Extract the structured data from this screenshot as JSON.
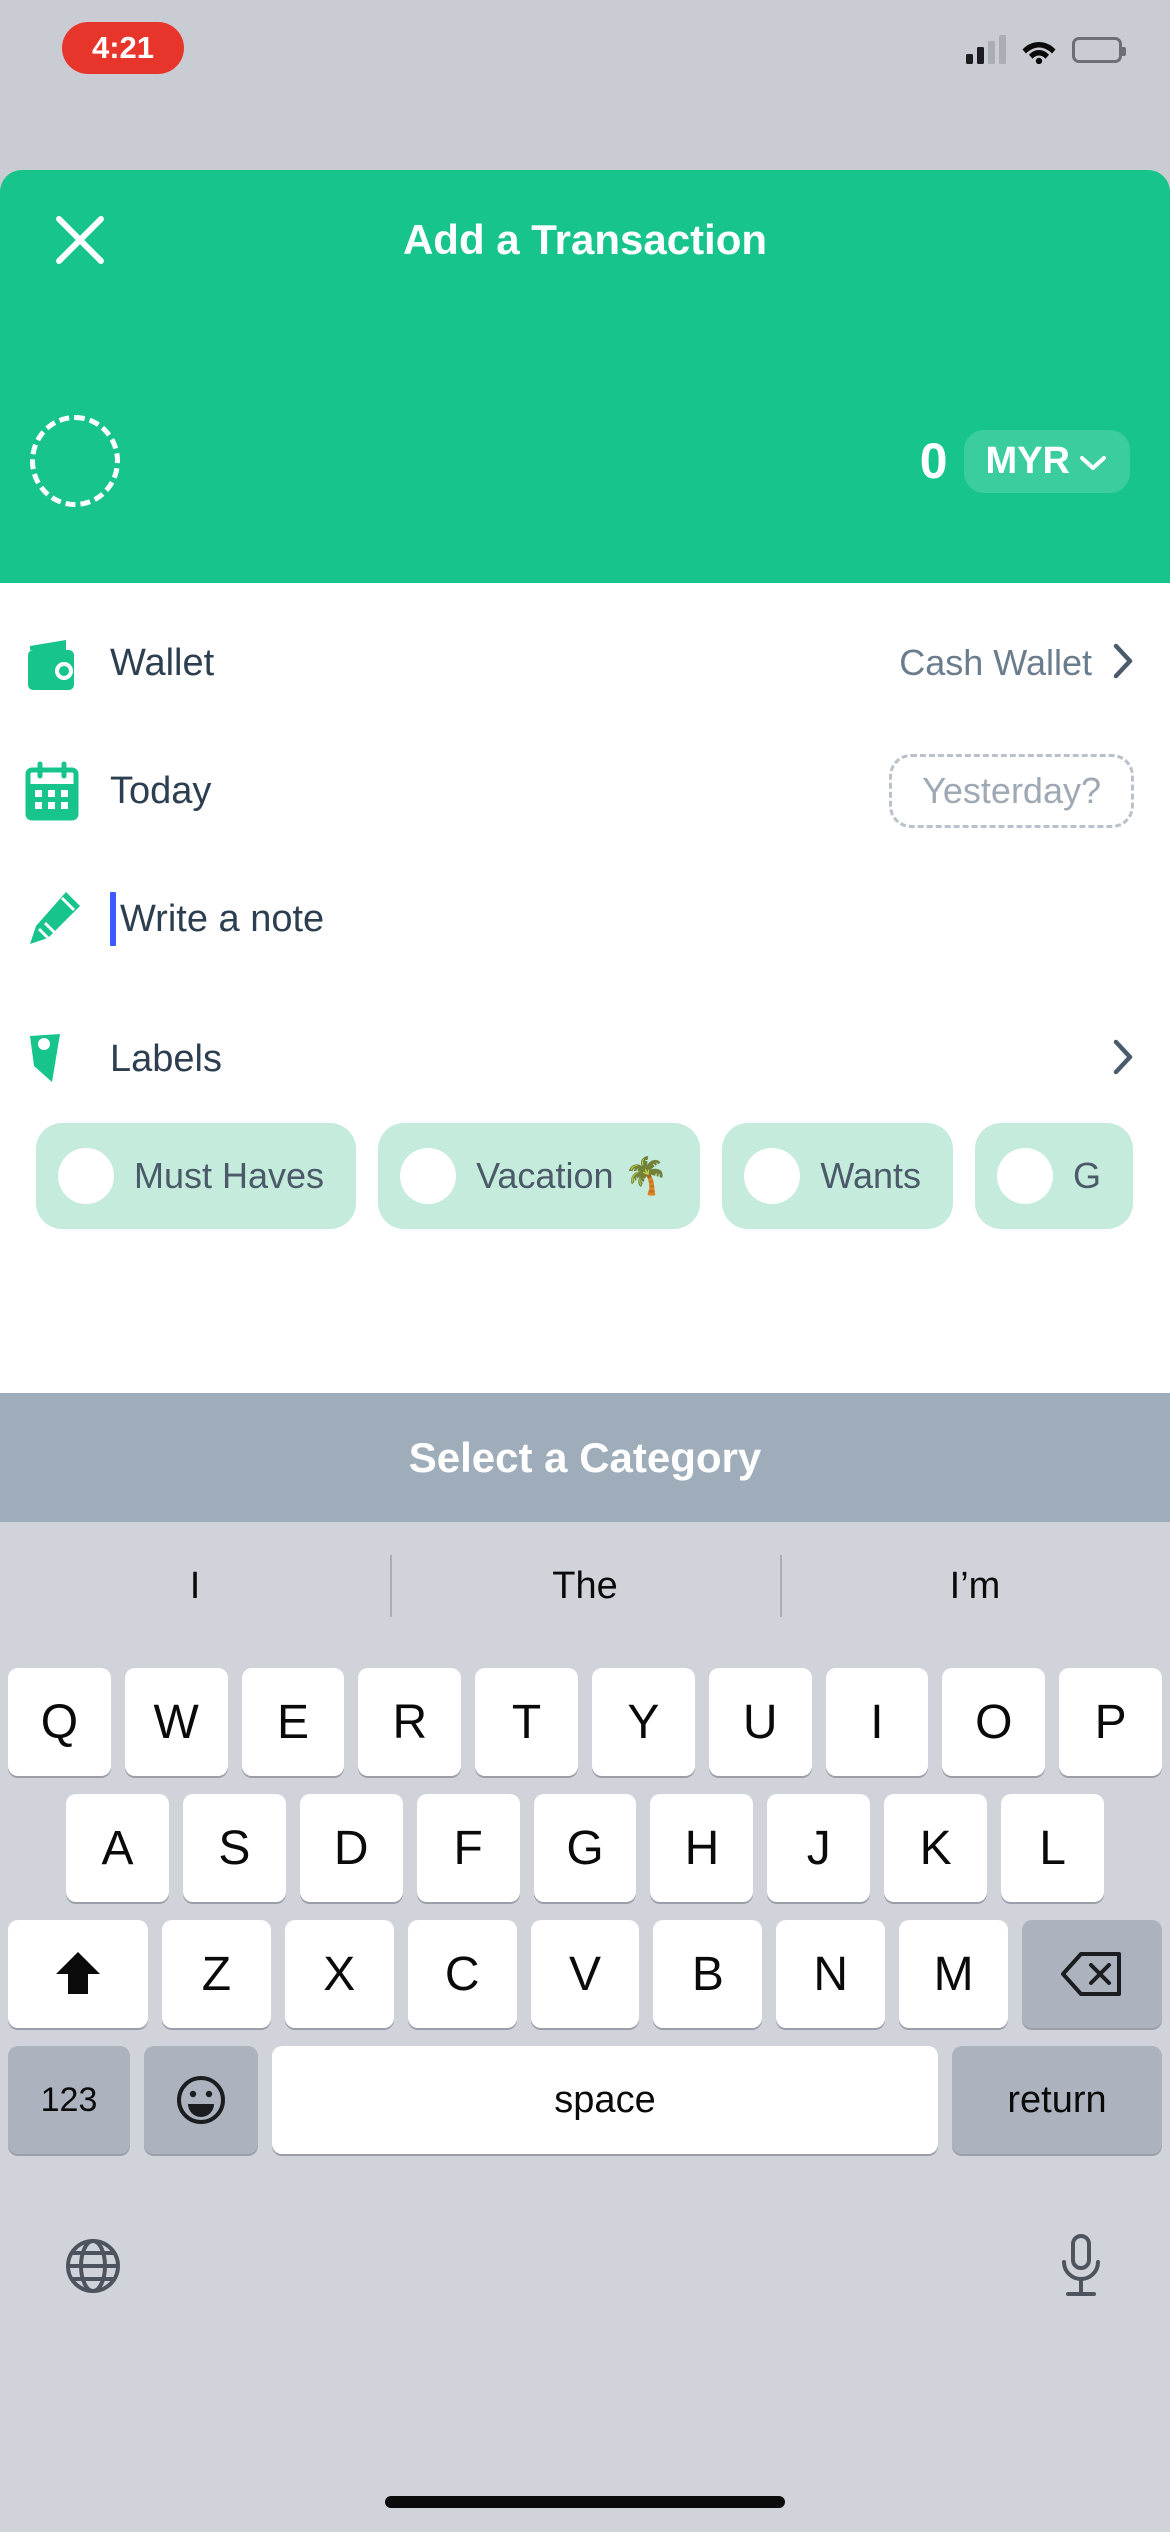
{
  "status_bar": {
    "time": "4:21",
    "recording_pill_color": "#e8352b",
    "signal_icon": "cellular-signal-icon",
    "wifi_icon": "wifi-icon",
    "battery_icon": "battery-low-icon"
  },
  "header": {
    "title": "Add a Transaction",
    "close_icon": "close-icon",
    "background_color": "#16c48c",
    "category_placeholder_icon": "dashed-circle-icon",
    "amount": "0",
    "currency": "MYR",
    "currency_chevron_icon": "chevron-down-icon"
  },
  "form": {
    "wallet": {
      "icon": "wallet-icon",
      "label": "Wallet",
      "value": "Cash Wallet",
      "chevron_icon": "chevron-right-icon"
    },
    "date": {
      "icon": "calendar-icon",
      "label": "Today",
      "suggestion": "Yesterday?"
    },
    "note": {
      "icon": "pencil-icon",
      "placeholder": "Write a note",
      "value": ""
    },
    "labels": {
      "icon": "tag-icon",
      "label": "Labels",
      "chevron_icon": "chevron-right-icon",
      "chips": [
        {
          "text": "Must Haves"
        },
        {
          "text": "Vacation 🌴"
        },
        {
          "text": "Wants"
        },
        {
          "text": "G"
        }
      ],
      "chip_background": "#c5ebdc"
    }
  },
  "category_bar": {
    "text": "Select a Category",
    "background_color": "#9eadb9"
  },
  "keyboard": {
    "predictions": [
      "I",
      "The",
      "I’m"
    ],
    "row1": [
      "Q",
      "W",
      "E",
      "R",
      "T",
      "Y",
      "U",
      "I",
      "O",
      "P"
    ],
    "row2": [
      "A",
      "S",
      "D",
      "F",
      "G",
      "H",
      "J",
      "K",
      "L"
    ],
    "row3_letters": [
      "Z",
      "X",
      "C",
      "V",
      "B",
      "N",
      "M"
    ],
    "shift_icon": "shift-arrow-icon",
    "backspace_icon": "backspace-icon",
    "numeric_key": "123",
    "emoji_icon": "emoji-smiley-icon",
    "space_key": "space",
    "return_key": "return",
    "globe_icon": "globe-icon",
    "microphone_icon": "microphone-icon"
  }
}
